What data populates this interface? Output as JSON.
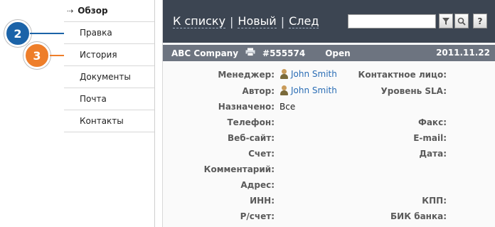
{
  "sidebar": {
    "items": [
      {
        "label": "Обзор",
        "marker": "⇢"
      },
      {
        "label": "Правка"
      },
      {
        "label": "История"
      },
      {
        "label": "Документы"
      },
      {
        "label": "Почта"
      },
      {
        "label": "Контакты"
      }
    ]
  },
  "callouts": {
    "blue": {
      "number": "2",
      "color": "#1b63a8"
    },
    "orange": {
      "number": "3",
      "color": "#ee7e2a"
    }
  },
  "topnav": {
    "back": "К списку",
    "new": "Новый",
    "next": "След",
    "separator": "|",
    "search_value": "",
    "filter_icon": "funnel-icon",
    "search_icon": "magnifier-icon",
    "help_label": "?"
  },
  "ticket": {
    "company": "ABC Company",
    "printer_icon": "printer-icon",
    "number": "#555574",
    "status": "Open",
    "date": "2011.11.22"
  },
  "fields": {
    "manager_label": "Менеджер:",
    "manager_value": "John Smith",
    "author_label": "Автор:",
    "author_value": "John Smith",
    "assigned_label": "Назначено:",
    "assigned_value": "Все",
    "phone_label": "Телефон:",
    "website_label": "Веб-сайт:",
    "account_label": "Счет:",
    "comment_label": "Комментарий:",
    "address_label": "Адрес:",
    "inn_label": "ИНН:",
    "rschet_label": "Р/счет:",
    "contact_label": "Контактное лицо:",
    "sla_label": "Уровень SLA:",
    "fax_label": "Факс:",
    "email_label": "E-mail:",
    "date_label": "Дата:",
    "kpp_label": "КПП:",
    "bik_label": "БИК банка:"
  }
}
